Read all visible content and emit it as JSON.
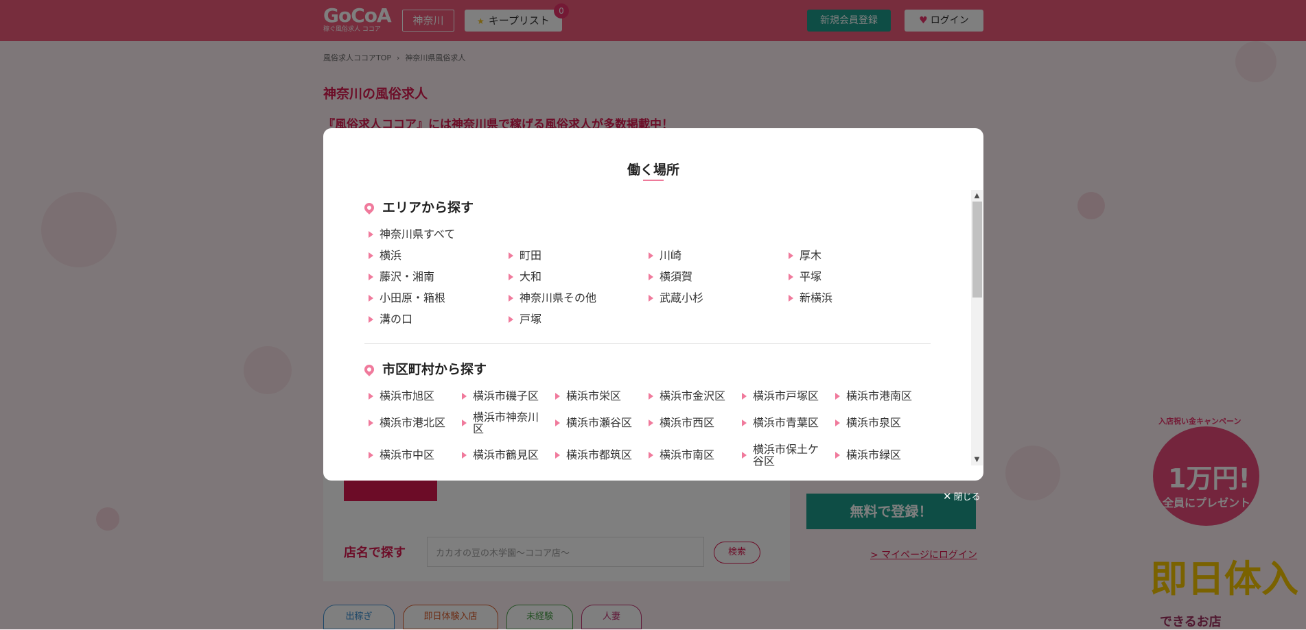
{
  "header": {
    "logo_main": "GoCoA",
    "logo_sub": "稼ぐ風俗求人 ココア",
    "area_button": "神奈川",
    "keep_list_label": "キープリスト",
    "keep_count": "0",
    "register_button": "新規会員登録",
    "login_button": "ログイン"
  },
  "breadcrumb": [
    "風俗求人ココアTOP",
    "›",
    "神奈川県風俗求人"
  ],
  "page": {
    "title": "神奈川の風俗求人",
    "lead": "『風俗求人ココア』には神奈川県で稼げる風俗求人が多数掲載中！",
    "shop_search_label": "店名で探す",
    "shop_search_placeholder": "カカオの豆の木学園～ココア店～",
    "shop_search_button": "検索",
    "free_register": "無料で登録！",
    "mypage_login": "> マイページにログイン",
    "tags": [
      "出稼ぎ",
      "即日体験入店",
      "未経験",
      "人妻"
    ],
    "promo_campaign": "入店祝い金キャンペーン",
    "promo_amount": "1万円!",
    "promo_present": "全員にプレゼント",
    "promo_sokujitsu": "即日体入",
    "promo_dekiru": "できるお店"
  },
  "modal": {
    "title": "働く場所",
    "area_section_title": "エリアから探す",
    "area_all": "神奈川県すべて",
    "areas": [
      "横浜",
      "町田",
      "川崎",
      "厚木",
      "藤沢・湘南",
      "大和",
      "横須賀",
      "平塚",
      "小田原・箱根",
      "神奈川県その他",
      "武蔵小杉",
      "新横浜",
      "溝の口",
      "戸塚"
    ],
    "city_section_title": "市区町村から探す",
    "cities": [
      "横浜市旭区",
      "横浜市磯子区",
      "横浜市栄区",
      "横浜市金沢区",
      "横浜市戸塚区",
      "横浜市港南区",
      "横浜市港北区",
      "横浜市神奈川区",
      "横浜市瀬谷区",
      "横浜市西区",
      "横浜市青葉区",
      "横浜市泉区",
      "横浜市中区",
      "横浜市鶴見区",
      "横浜市都筑区",
      "横浜市南区",
      "横浜市保土ケ谷区",
      "横浜市緑区"
    ],
    "close_label": "閉じる"
  },
  "colors": {
    "brand_pink": "#ee5a7a",
    "accent_red": "#d9194e",
    "register_green": "#1d9a8a",
    "bullet_pink": "#f07a9c"
  }
}
